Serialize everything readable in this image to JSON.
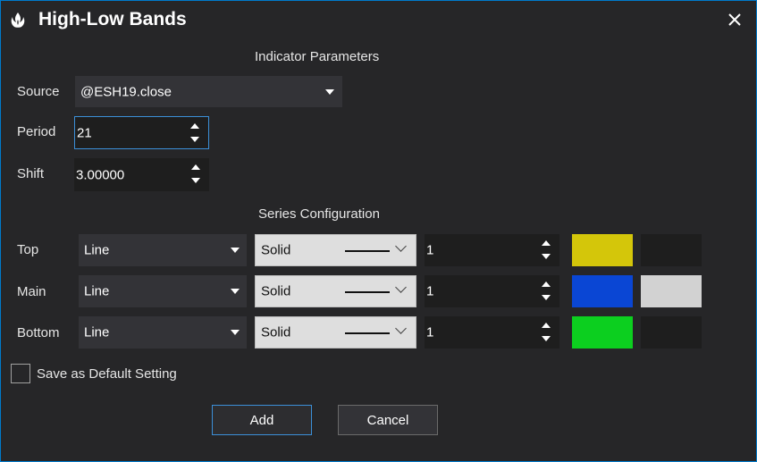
{
  "window": {
    "title": "High-Low Bands",
    "app_icon": "flame-logo-icon",
    "close_icon": "close-icon"
  },
  "indicator": {
    "section_title": "Indicator Parameters",
    "source_label": "Source",
    "source_value": "@ESH19.close",
    "period_label": "Period",
    "period_value": "21",
    "shift_label": "Shift",
    "shift_value": "3.00000"
  },
  "series": {
    "section_title": "Series Configuration",
    "rows": [
      {
        "label": "Top",
        "type": "Line",
        "style": "Solid",
        "width": "1",
        "color": "#d4c60a",
        "color2": "#1e1e1e"
      },
      {
        "label": "Main",
        "type": "Line",
        "style": "Solid",
        "width": "1",
        "color": "#0a46d4",
        "color2": "#d2d2d2"
      },
      {
        "label": "Bottom",
        "type": "Line",
        "style": "Solid",
        "width": "1",
        "color": "#0ccf1f",
        "color2": "#1e1e1e"
      }
    ]
  },
  "save_default": {
    "label": "Save as Default Setting",
    "checked": false
  },
  "buttons": {
    "add": "Add",
    "cancel": "Cancel"
  }
}
